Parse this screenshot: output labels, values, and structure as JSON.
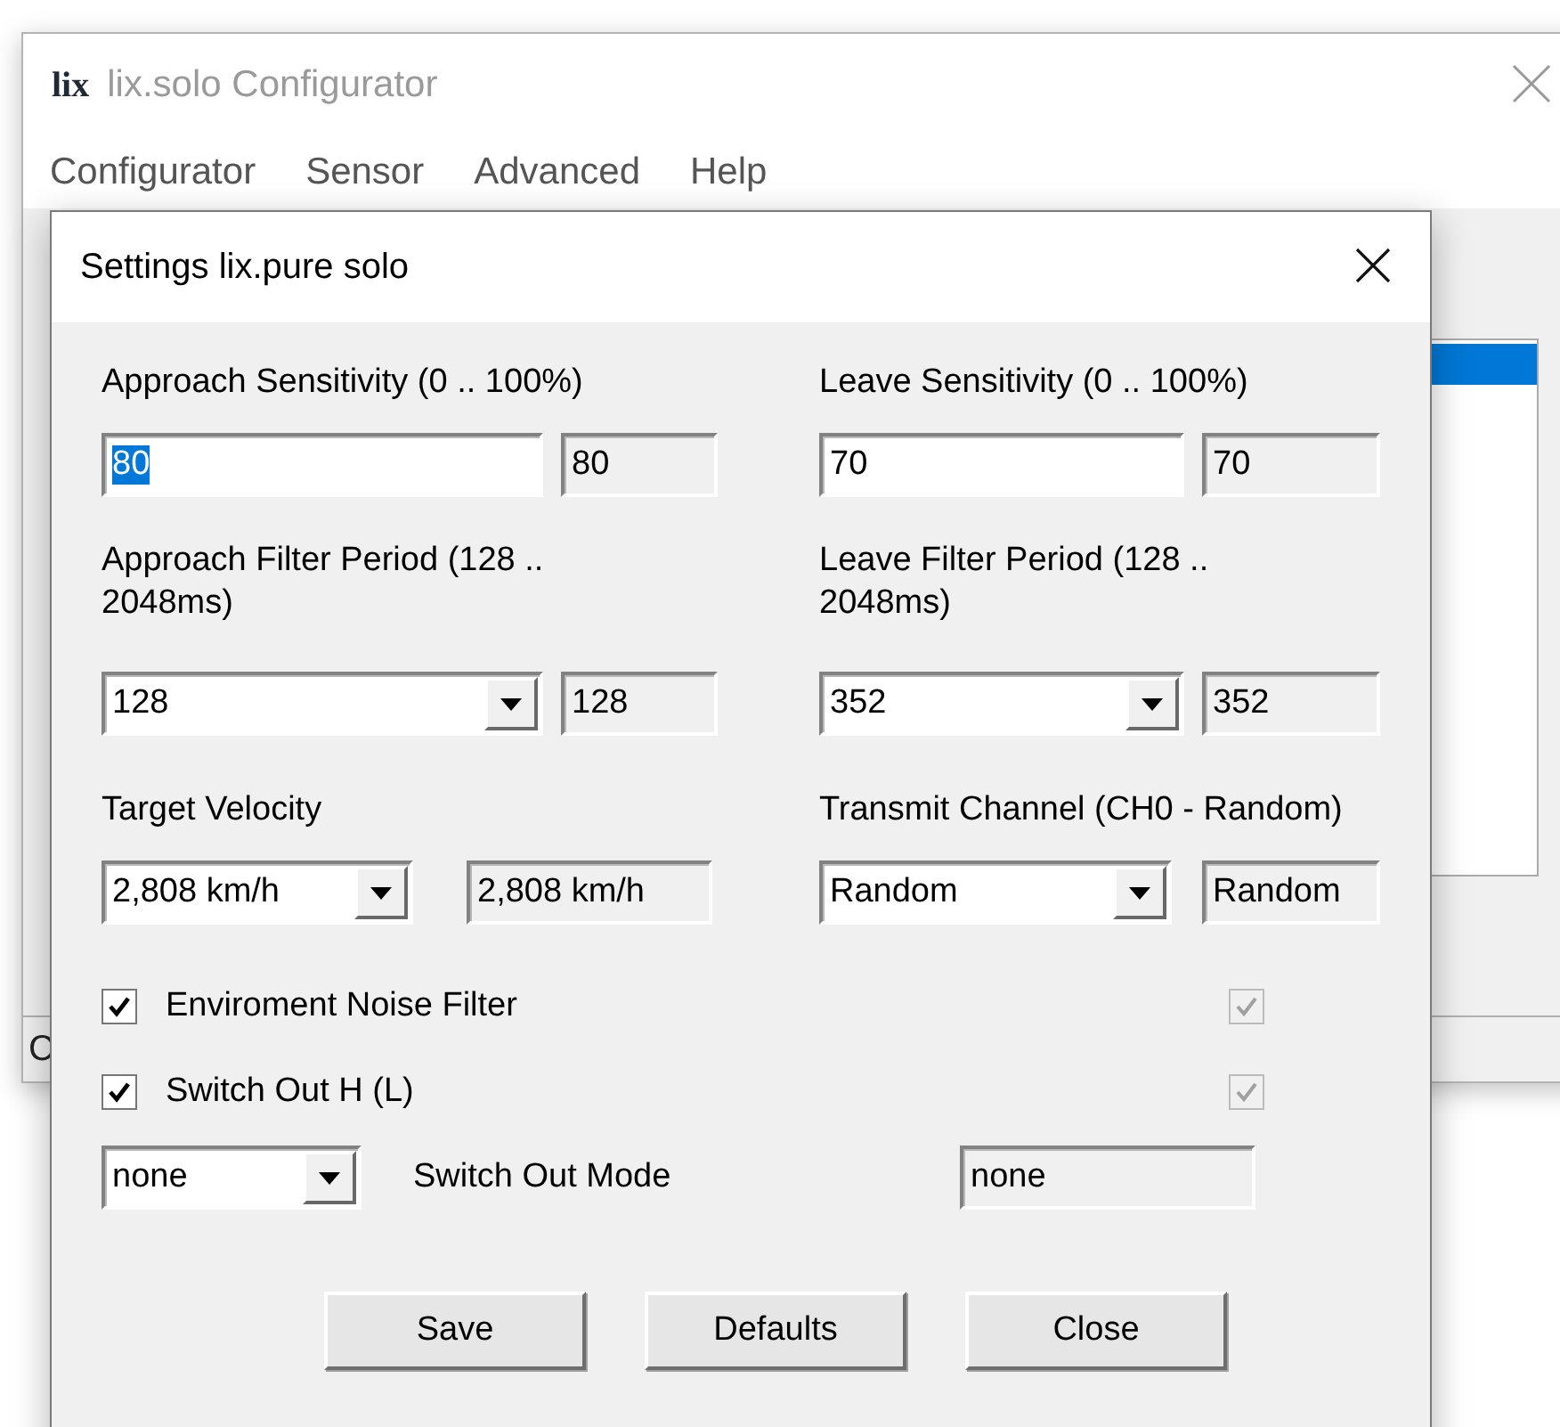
{
  "main_window": {
    "logo": "lix",
    "title": "lix.solo Configurator",
    "menu": [
      "Configurator",
      "Sensor",
      "Advanced",
      "Help"
    ],
    "listbox": {
      "rows": [
        {
          "selected": true
        }
      ]
    },
    "status_bar": {
      "text": "C"
    }
  },
  "dialog": {
    "title": "Settings lix.pure solo",
    "fields": [
      {
        "label": "Approach Sensitivity (0 .. 100%)",
        "kind": "text",
        "value": "80",
        "text_selected": true,
        "readout": "80"
      },
      {
        "label": "Leave Sensitivity (0 .. 100%)",
        "kind": "text",
        "value": "70",
        "text_selected": false,
        "readout": "70"
      },
      {
        "label": "Approach Filter Period (128 .. 2048ms)",
        "kind": "combo",
        "value": "128",
        "readout": "128"
      },
      {
        "label": "Leave Filter Period (128 .. 2048ms)",
        "kind": "combo",
        "value": "352",
        "readout": "352"
      },
      {
        "label": "Target Velocity",
        "kind": "shortcombo",
        "value": "2,808 km/h",
        "readout": "2,808 km/h"
      },
      {
        "label": "Transmit Channel (CH0 - Random)",
        "kind": "combo",
        "value": "Random",
        "readout": "Random"
      }
    ],
    "checkboxes": [
      {
        "label": "Enviroment Noise Filter",
        "checked": true,
        "mirror_checked": true
      },
      {
        "label": "Switch Out H (L)",
        "checked": true,
        "mirror_checked": true
      }
    ],
    "switch_out_mode": {
      "value": "none",
      "label": "Switch Out Mode",
      "readout": "none"
    },
    "buttons": [
      "Save",
      "Defaults",
      "Close"
    ]
  }
}
